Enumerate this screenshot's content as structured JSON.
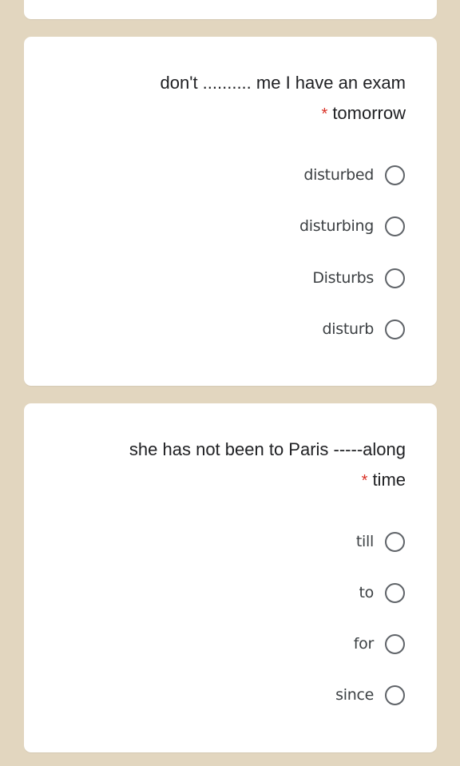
{
  "questions": [
    {
      "title_line1": "don't .......... me I have an exam",
      "required_marker": "*",
      "title_line2": "tomorrow",
      "options": [
        "disturbed",
        "disturbing",
        "Disturbs",
        "disturb"
      ]
    },
    {
      "title_line1": "she has not been to Paris -----along",
      "required_marker": "*",
      "title_line2": "time",
      "options": [
        "till",
        "to",
        "for",
        "since"
      ]
    }
  ],
  "colors": {
    "background": "#e2d6bf",
    "card": "#ffffff",
    "required": "#d93025",
    "radio_border": "#5f6368"
  }
}
